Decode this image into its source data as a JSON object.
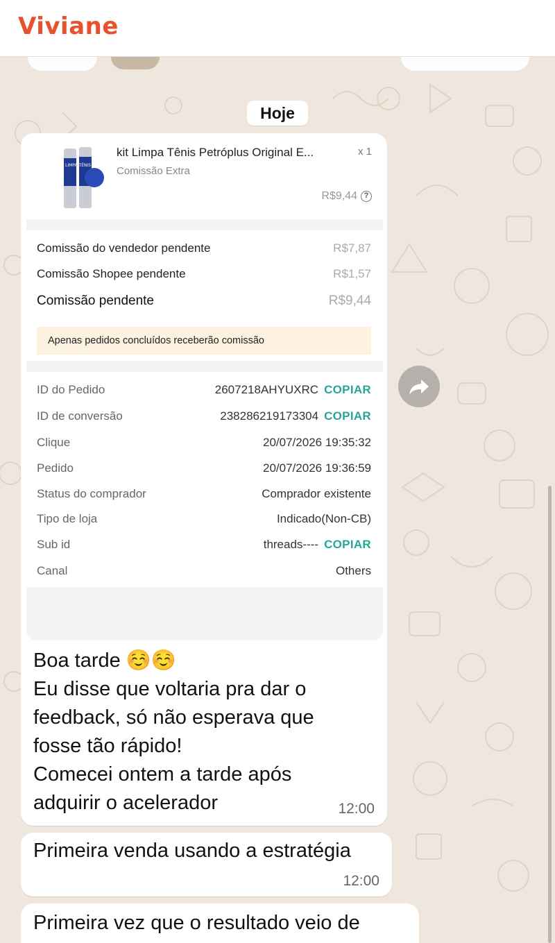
{
  "header": {
    "contact_name": "Viviane"
  },
  "chat": {
    "day_label": "Hoje",
    "card": {
      "product": {
        "title": "kit Limpa Tênis Petróplus Original E...",
        "quantity": "x 1",
        "subtitle": "Comissão Extra",
        "price": "R$9,44",
        "image_label": "LIMPA TÊNIS"
      },
      "commissions": [
        {
          "label": "Comissão do vendedor pendente",
          "value": "R$7,87"
        },
        {
          "label": "Comissão Shopee pendente",
          "value": "R$1,57"
        },
        {
          "label": "Comissão pendente",
          "value": "R$9,44"
        }
      ],
      "notice": "Apenas pedidos concluídos receberão comissão",
      "details": [
        {
          "label": "ID do Pedido",
          "value": "2607218AHYUXRC",
          "action": "COPIAR"
        },
        {
          "label": "ID de conversão",
          "value": "238286219173304",
          "action": "COPIAR"
        },
        {
          "label": "Clique",
          "value": "20/07/2026 19:35:32"
        },
        {
          "label": "Pedido",
          "value": "20/07/2026 19:36:59"
        },
        {
          "label": "Status do comprador",
          "value": "Comprador existente"
        },
        {
          "label": "Tipo de loja",
          "value": "Indicado(Non-CB)"
        },
        {
          "label": "Sub id",
          "value": "threads----",
          "action": "COPIAR"
        },
        {
          "label": "Canal",
          "value": "Others"
        }
      ]
    },
    "messages": [
      {
        "lines": [
          "Boa tarde ☺️☺️",
          "Eu disse que voltaria pra dar o",
          "feedback, só não esperava que",
          "fosse tão rápido!",
          "Comecei ontem a tarde após",
          "adquirir o acelerador"
        ],
        "time": "12:00"
      },
      {
        "lines": [
          "Primeira venda usando a estratégia"
        ],
        "time": "12:00"
      },
      {
        "lines": [
          "Primeira vez que o resultado veio de"
        ]
      }
    ]
  },
  "icons": {
    "forward": "forward-arrow-icon",
    "help": "question-icon"
  },
  "colors": {
    "brand": "#e8512d",
    "copy": "#26a69a",
    "notice_bg": "#fdf2e0",
    "chat_bg": "#efe7dd"
  }
}
